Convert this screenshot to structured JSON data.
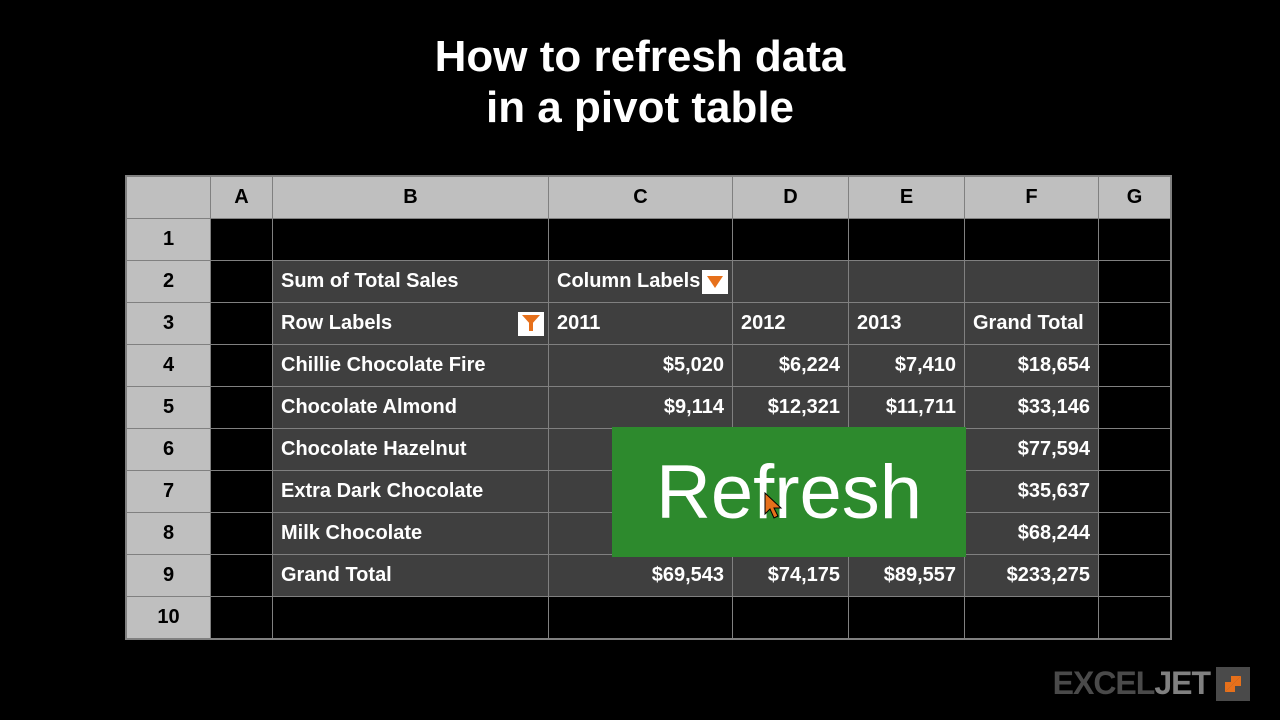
{
  "title_line1": "How to refresh data",
  "title_line2": "in a pivot table",
  "columns": [
    "A",
    "B",
    "C",
    "D",
    "E",
    "F",
    "G"
  ],
  "row_numbers": [
    "1",
    "2",
    "3",
    "4",
    "5",
    "6",
    "7",
    "8",
    "9",
    "10"
  ],
  "pivot": {
    "sum_label": "Sum of Total Sales",
    "column_labels": "Column Labels",
    "row_labels": "Row Labels",
    "years": {
      "y1": "2011",
      "y2": "2012",
      "y3": "2013"
    },
    "grand_total_col": "Grand Total",
    "rows": [
      {
        "name": "Chillie Chocolate Fire",
        "y1": "$5,020",
        "y2": "$6,224",
        "y3": "$7,410",
        "total": "$18,654"
      },
      {
        "name": "Chocolate Almond",
        "y1": "$9,114",
        "y2": "$12,321",
        "y3": "$11,711",
        "total": "$33,146"
      },
      {
        "name": "Chocolate Hazelnut",
        "y1": "",
        "y2": "",
        "y3": "",
        "total": "$77,594"
      },
      {
        "name": "Extra Dark Chocolate",
        "y1": "",
        "y2": "",
        "y3": "",
        "total": "$35,637"
      },
      {
        "name": "Milk Chocolate",
        "y1": "",
        "y2": "",
        "y3": "",
        "total": "$68,244"
      }
    ],
    "grand_total_row": {
      "label": "Grand Total",
      "y1": "$69,543",
      "y2": "$74,175",
      "y3": "$89,557",
      "total": "$233,275"
    }
  },
  "overlay_label": "Refresh",
  "logo": {
    "part1": "EXCEL",
    "part2": "JET"
  }
}
